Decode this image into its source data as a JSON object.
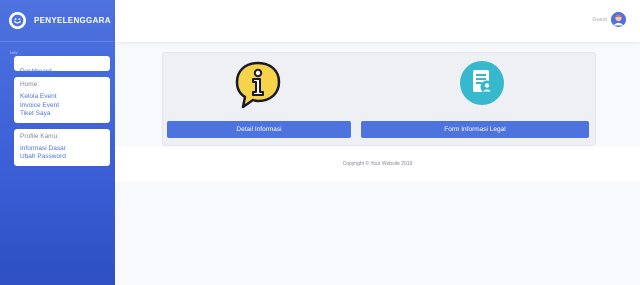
{
  "brand": {
    "title": "PENYELENGGARA",
    "icon": "smiley-icon"
  },
  "sidebar": {
    "section_label": "Nav",
    "dashboard": "Dashboard",
    "home": {
      "title": "Home:",
      "items": [
        "Kelola Event",
        "Invoice Event",
        "Tiket Saya"
      ]
    },
    "profile": {
      "title": "Profile Kamu:",
      "items": [
        "Informasi Dasar",
        "Ubah Password"
      ]
    }
  },
  "topbar": {
    "user_name": "Guest",
    "avatar": "user-avatar-icon"
  },
  "main": {
    "left": {
      "icon": "info-chat-icon",
      "button": "Detail Informasi"
    },
    "right": {
      "icon": "document-user-icon",
      "button": "Form Informasi Legal"
    }
  },
  "footer": {
    "text": "Copyright © Your Website 2019"
  },
  "colors": {
    "primary": "#4e73df",
    "sky": "#36b9cc",
    "yellow": "#f6d34a"
  }
}
